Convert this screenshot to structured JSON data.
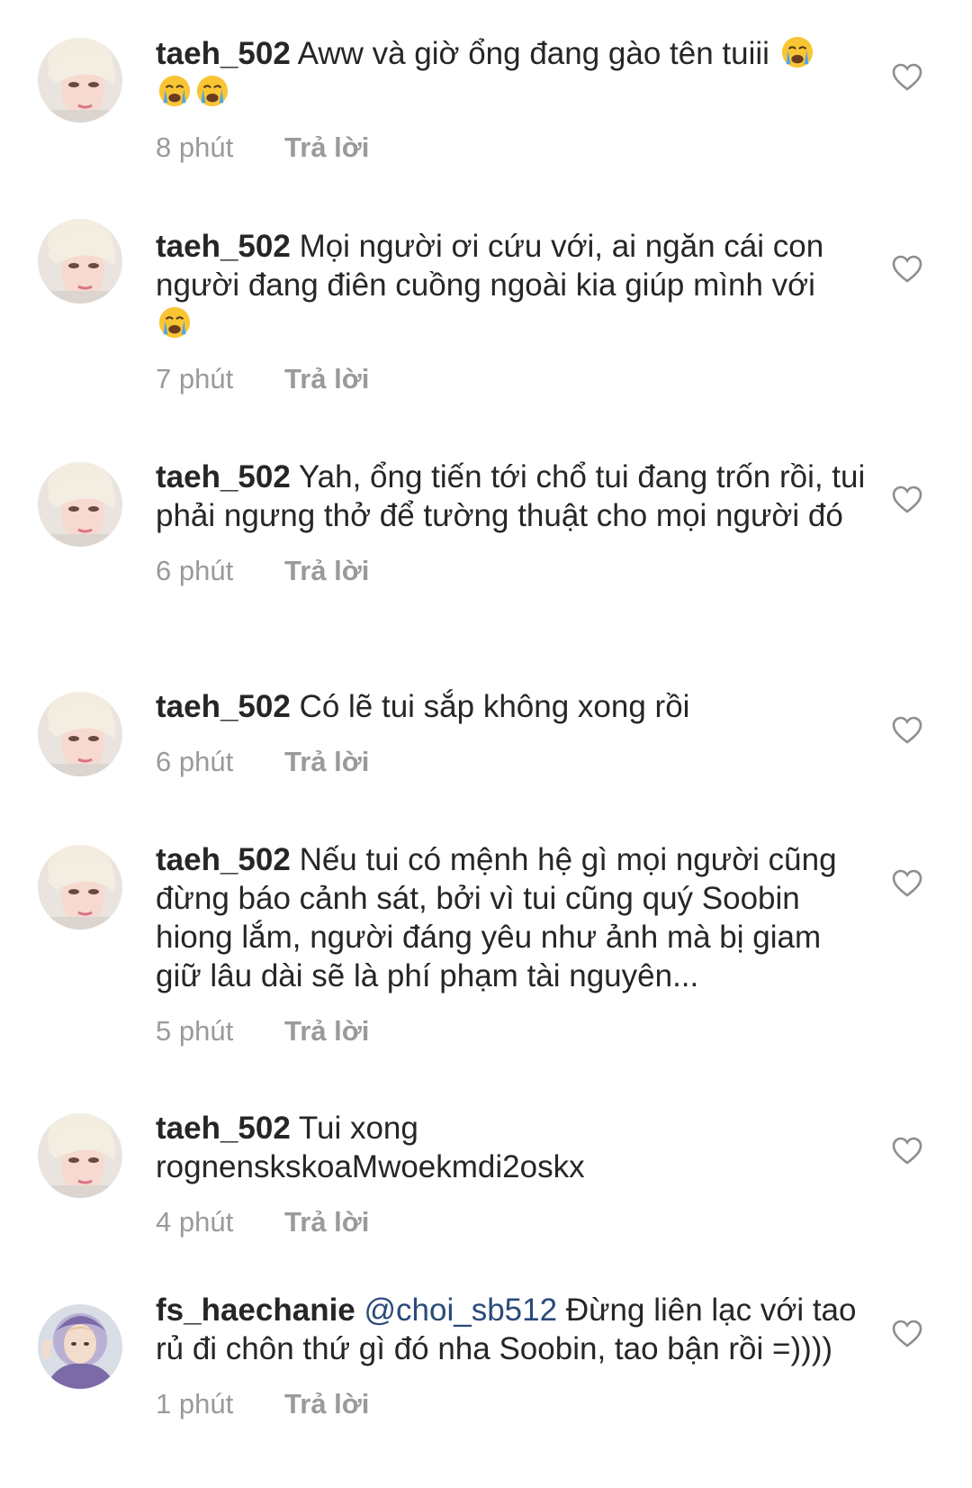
{
  "comments": [
    {
      "username": "taeh_502",
      "text": "Aww và giờ ổng đang gào tên tuiii",
      "emojis_after_text": [
        "crying-face",
        "crying-face",
        "crying-face"
      ],
      "time": "8 phút",
      "reply_label": "Trả lời",
      "avatar": "taeh-avatar"
    },
    {
      "username": "taeh_502",
      "text": "Mọi người ơi cứu với, ai ngăn cái con người đang điên cuồng ngoài kia giúp mình với",
      "emojis_after_text": [
        "crying-face"
      ],
      "time": "7 phút",
      "reply_label": "Trả lời",
      "avatar": "taeh-avatar"
    },
    {
      "username": "taeh_502",
      "text": "Yah, ổng tiến tới chổ tui đang trốn rồi, tui phải ngưng thở để tường thuật cho mọi người đó",
      "emojis_after_text": [],
      "time": "6 phút",
      "reply_label": "Trả lời",
      "avatar": "taeh-avatar"
    },
    {
      "username": "taeh_502",
      "text": "Có lẽ tui sắp không xong rồi",
      "emojis_after_text": [],
      "time": "6 phút",
      "reply_label": "Trả lời",
      "avatar": "taeh-avatar"
    },
    {
      "username": "taeh_502",
      "text": "Nếu tui có mệnh hệ gì mọi người cũng đừng báo cảnh sát, bởi vì tui cũng quý Soobin hiong lắm, người đáng yêu như ảnh mà bị giam giữ lâu dài sẽ là phí phạm tài nguyên...",
      "emojis_after_text": [],
      "time": "5 phút",
      "reply_label": "Trả lời",
      "avatar": "taeh-avatar"
    },
    {
      "username": "taeh_502",
      "text": "Tui xong rognenskskoaMwoekmdi2oskx",
      "emojis_after_text": [],
      "time": "4 phút",
      "reply_label": "Trả lời",
      "avatar": "taeh-avatar"
    },
    {
      "username": "fs_haechanie",
      "mention": "@choi_sb512",
      "text": "Đừng liên lạc với tao rủ đi chôn thứ gì đó nha Soobin, tao bận rồi =))))",
      "emojis_after_text": [],
      "time": "1 phút",
      "reply_label": "Trả lời",
      "avatar": "haechanie-avatar"
    }
  ],
  "colors": {
    "text": "#262626",
    "meta": "#9a9a9a",
    "mention": "#2b4a7a",
    "heart_outline": "#8e8e8e",
    "background": "#ffffff"
  },
  "icons": {
    "like": "heart-outline-icon",
    "emoji": "crying-face-emoji"
  }
}
